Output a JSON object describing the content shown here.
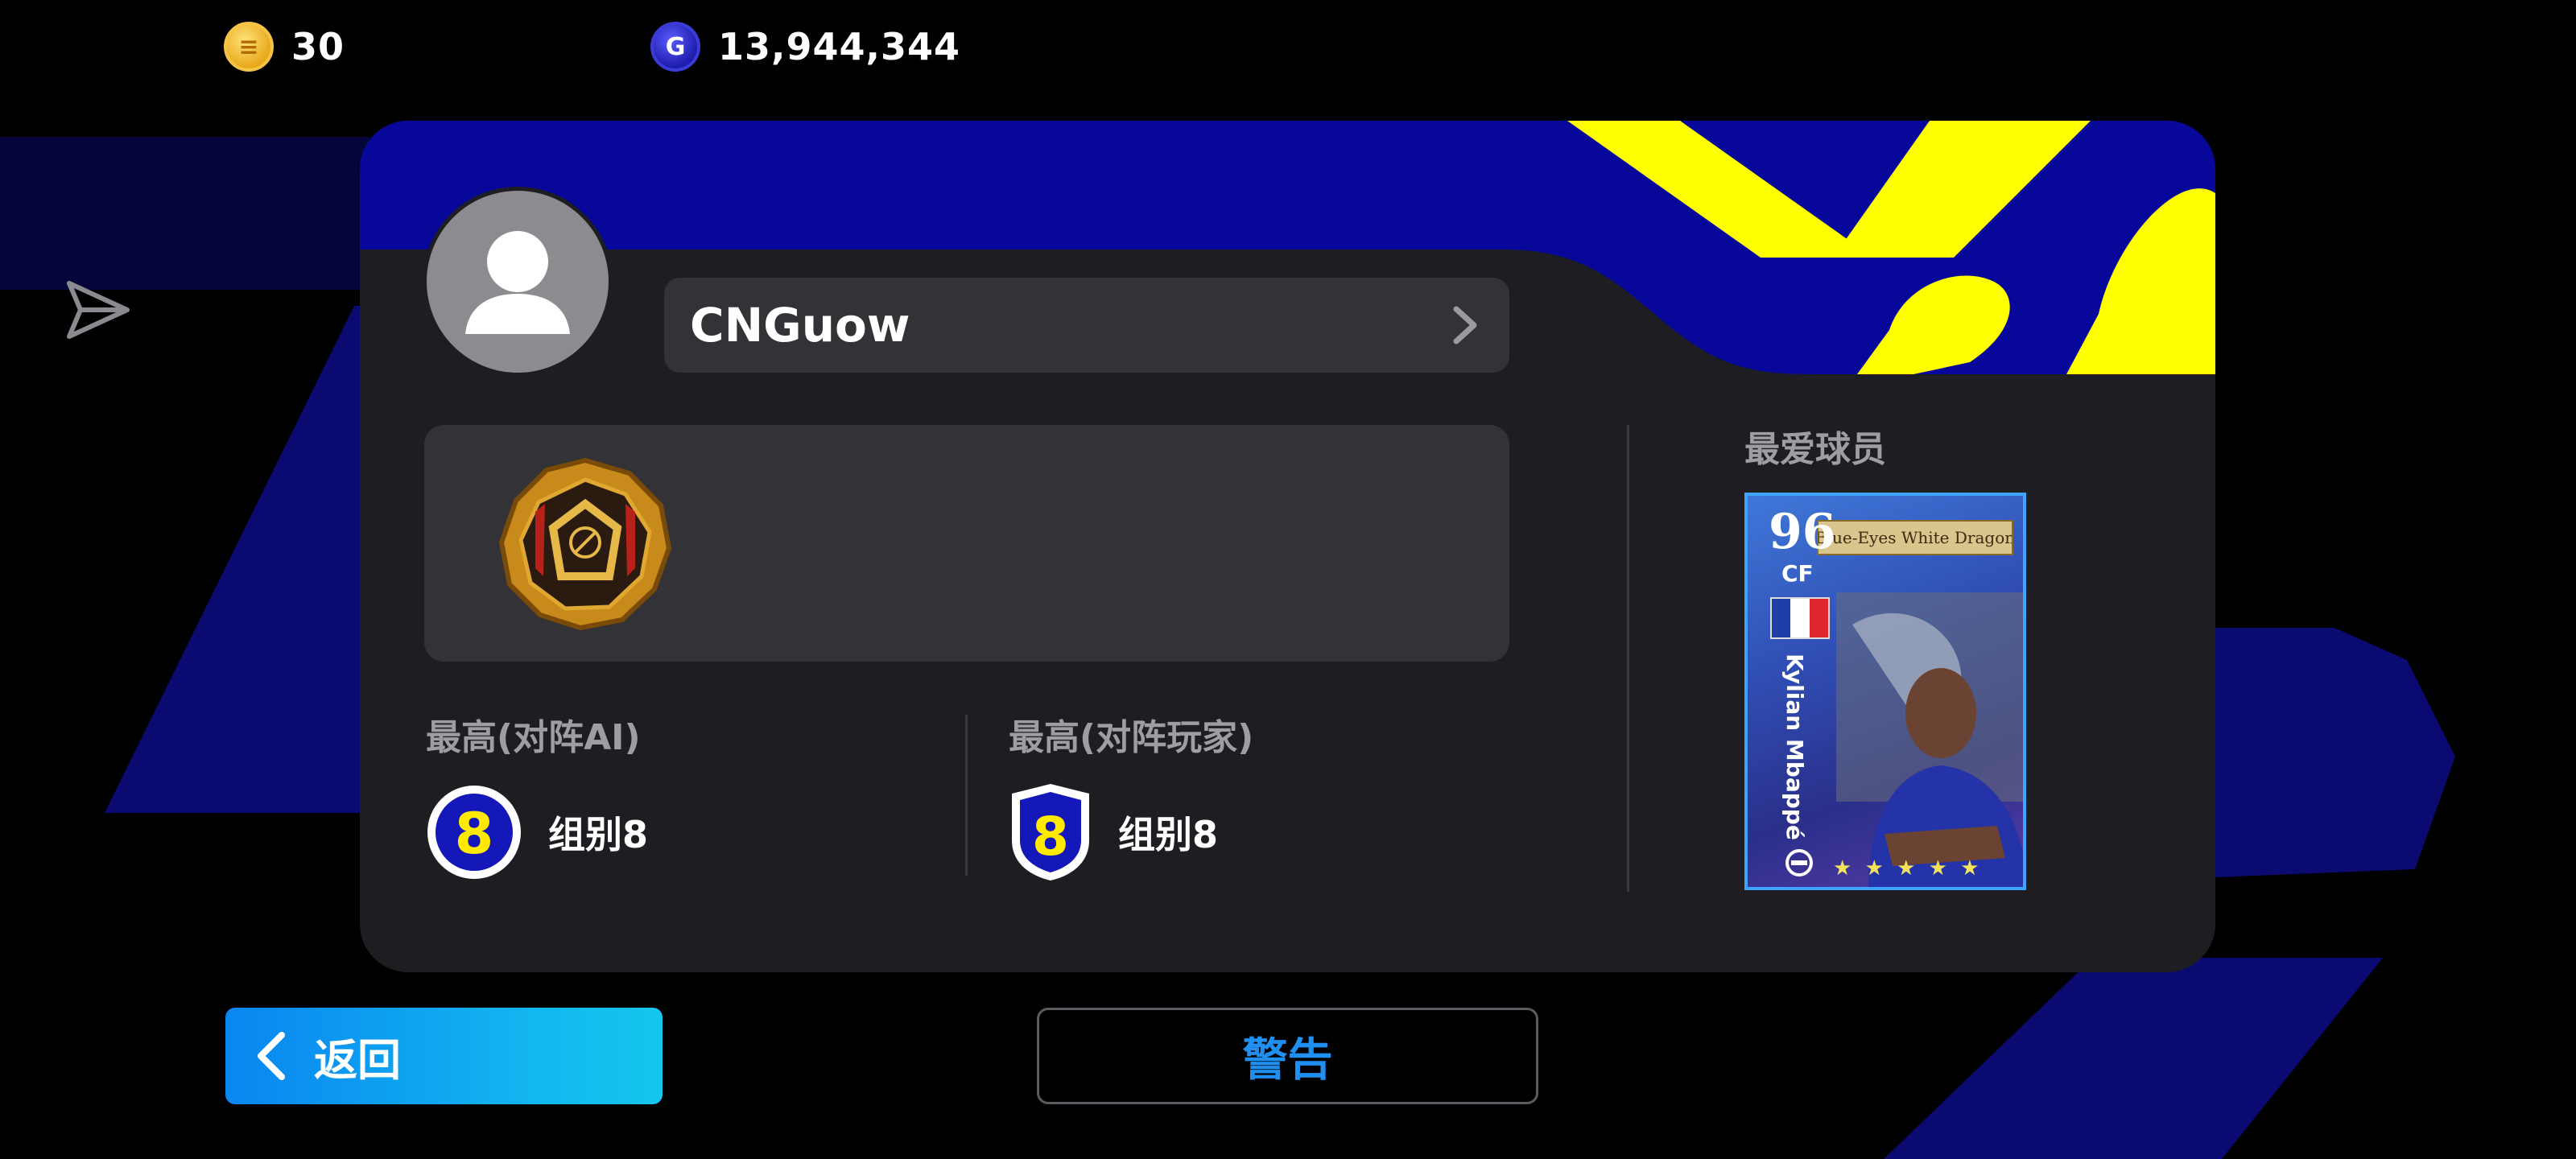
{
  "currencies": [
    {
      "icon": "coin-icon",
      "value": "30"
    },
    {
      "icon": "gp-icon",
      "letter": "G",
      "value": "13,944,344"
    }
  ],
  "profile": {
    "username": "CNGuow"
  },
  "ranks": {
    "vs_ai": {
      "title": "最高(对阵AI)",
      "badge_number": "8",
      "value": "组别8"
    },
    "vs_players": {
      "title": "最高(对阵玩家)",
      "badge_number": "8",
      "value": "组别8"
    }
  },
  "favorite_player": {
    "section_title": "最爱球员",
    "rating": "96",
    "position": "CF",
    "name": "Kylian Mbappé",
    "card_title": "Blue-Eyes White Dragon",
    "stars": "★ ★ ★ ★ ★",
    "nationality_flag": "france-flag"
  },
  "buttons": {
    "back_label": "返回",
    "warn_label": "警告"
  },
  "colors": {
    "accent_blue": "#0a86f0",
    "header_navy": "#07079a",
    "header_yellow": "#ffff00",
    "card_bg": "#1e1e22",
    "panel_bg": "#333337"
  }
}
